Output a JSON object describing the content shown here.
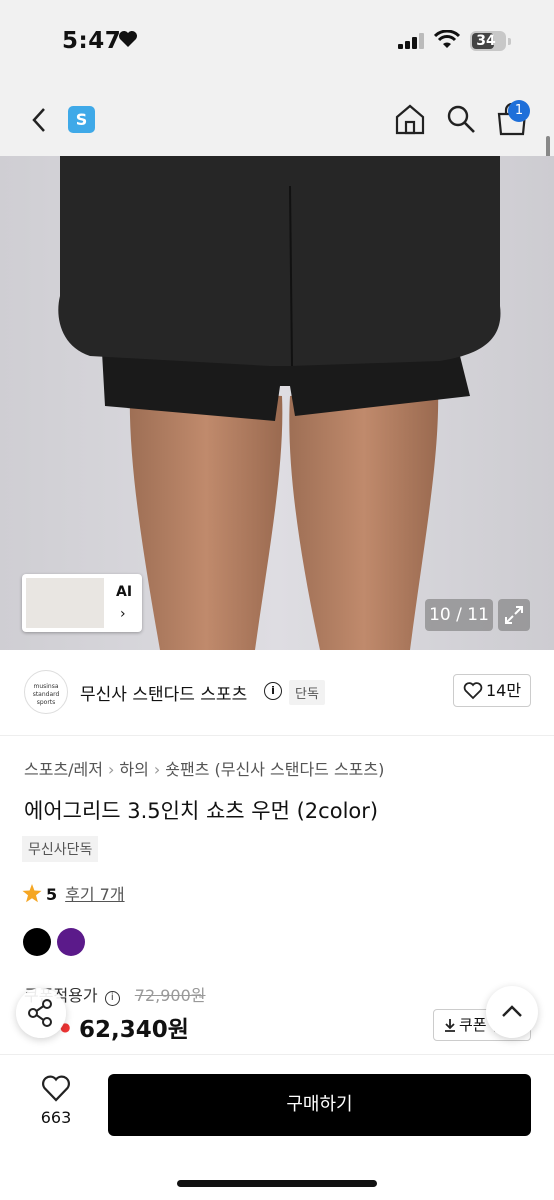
{
  "status_bar": {
    "time": "5:47",
    "battery": "34"
  },
  "nav": {
    "app_badge": "S",
    "cart_count": "1"
  },
  "gallery": {
    "counter": "10 / 11",
    "thumb_label": "AI",
    "thumb_chevron": "›"
  },
  "brand": {
    "logo_text": "musinsa standard sports",
    "name": "무신사 스탠다드 스포츠",
    "info": "i",
    "exclusive_tag": "단독",
    "likes": "14만"
  },
  "breadcrumb": [
    "스포츠/레저",
    "하의",
    "숏팬츠 (무신사 스탠다드 스포츠)"
  ],
  "breadcrumb_sep": "›",
  "product": {
    "title": "에어그리드 3.5인치 쇼츠 우먼 (2color)",
    "tag": "무신사단독",
    "rating": "5",
    "review_count": "후기 7개",
    "colors": [
      "#000000",
      "#5b1a8a"
    ]
  },
  "price": {
    "label": "쿠폰적용가",
    "original": "72,900원",
    "current": "62,340원",
    "coupon_label": "쿠폰 받기"
  },
  "bottom": {
    "wish_count": "663",
    "buy_label": "구매하기"
  },
  "icons": [
    "heart-icon",
    "signal-icon",
    "wifi-icon",
    "back-icon",
    "home-icon",
    "search-icon",
    "cart-icon",
    "expand-icon",
    "info-icon",
    "star-icon",
    "share-icon",
    "chevron-up-icon",
    "download-icon"
  ]
}
